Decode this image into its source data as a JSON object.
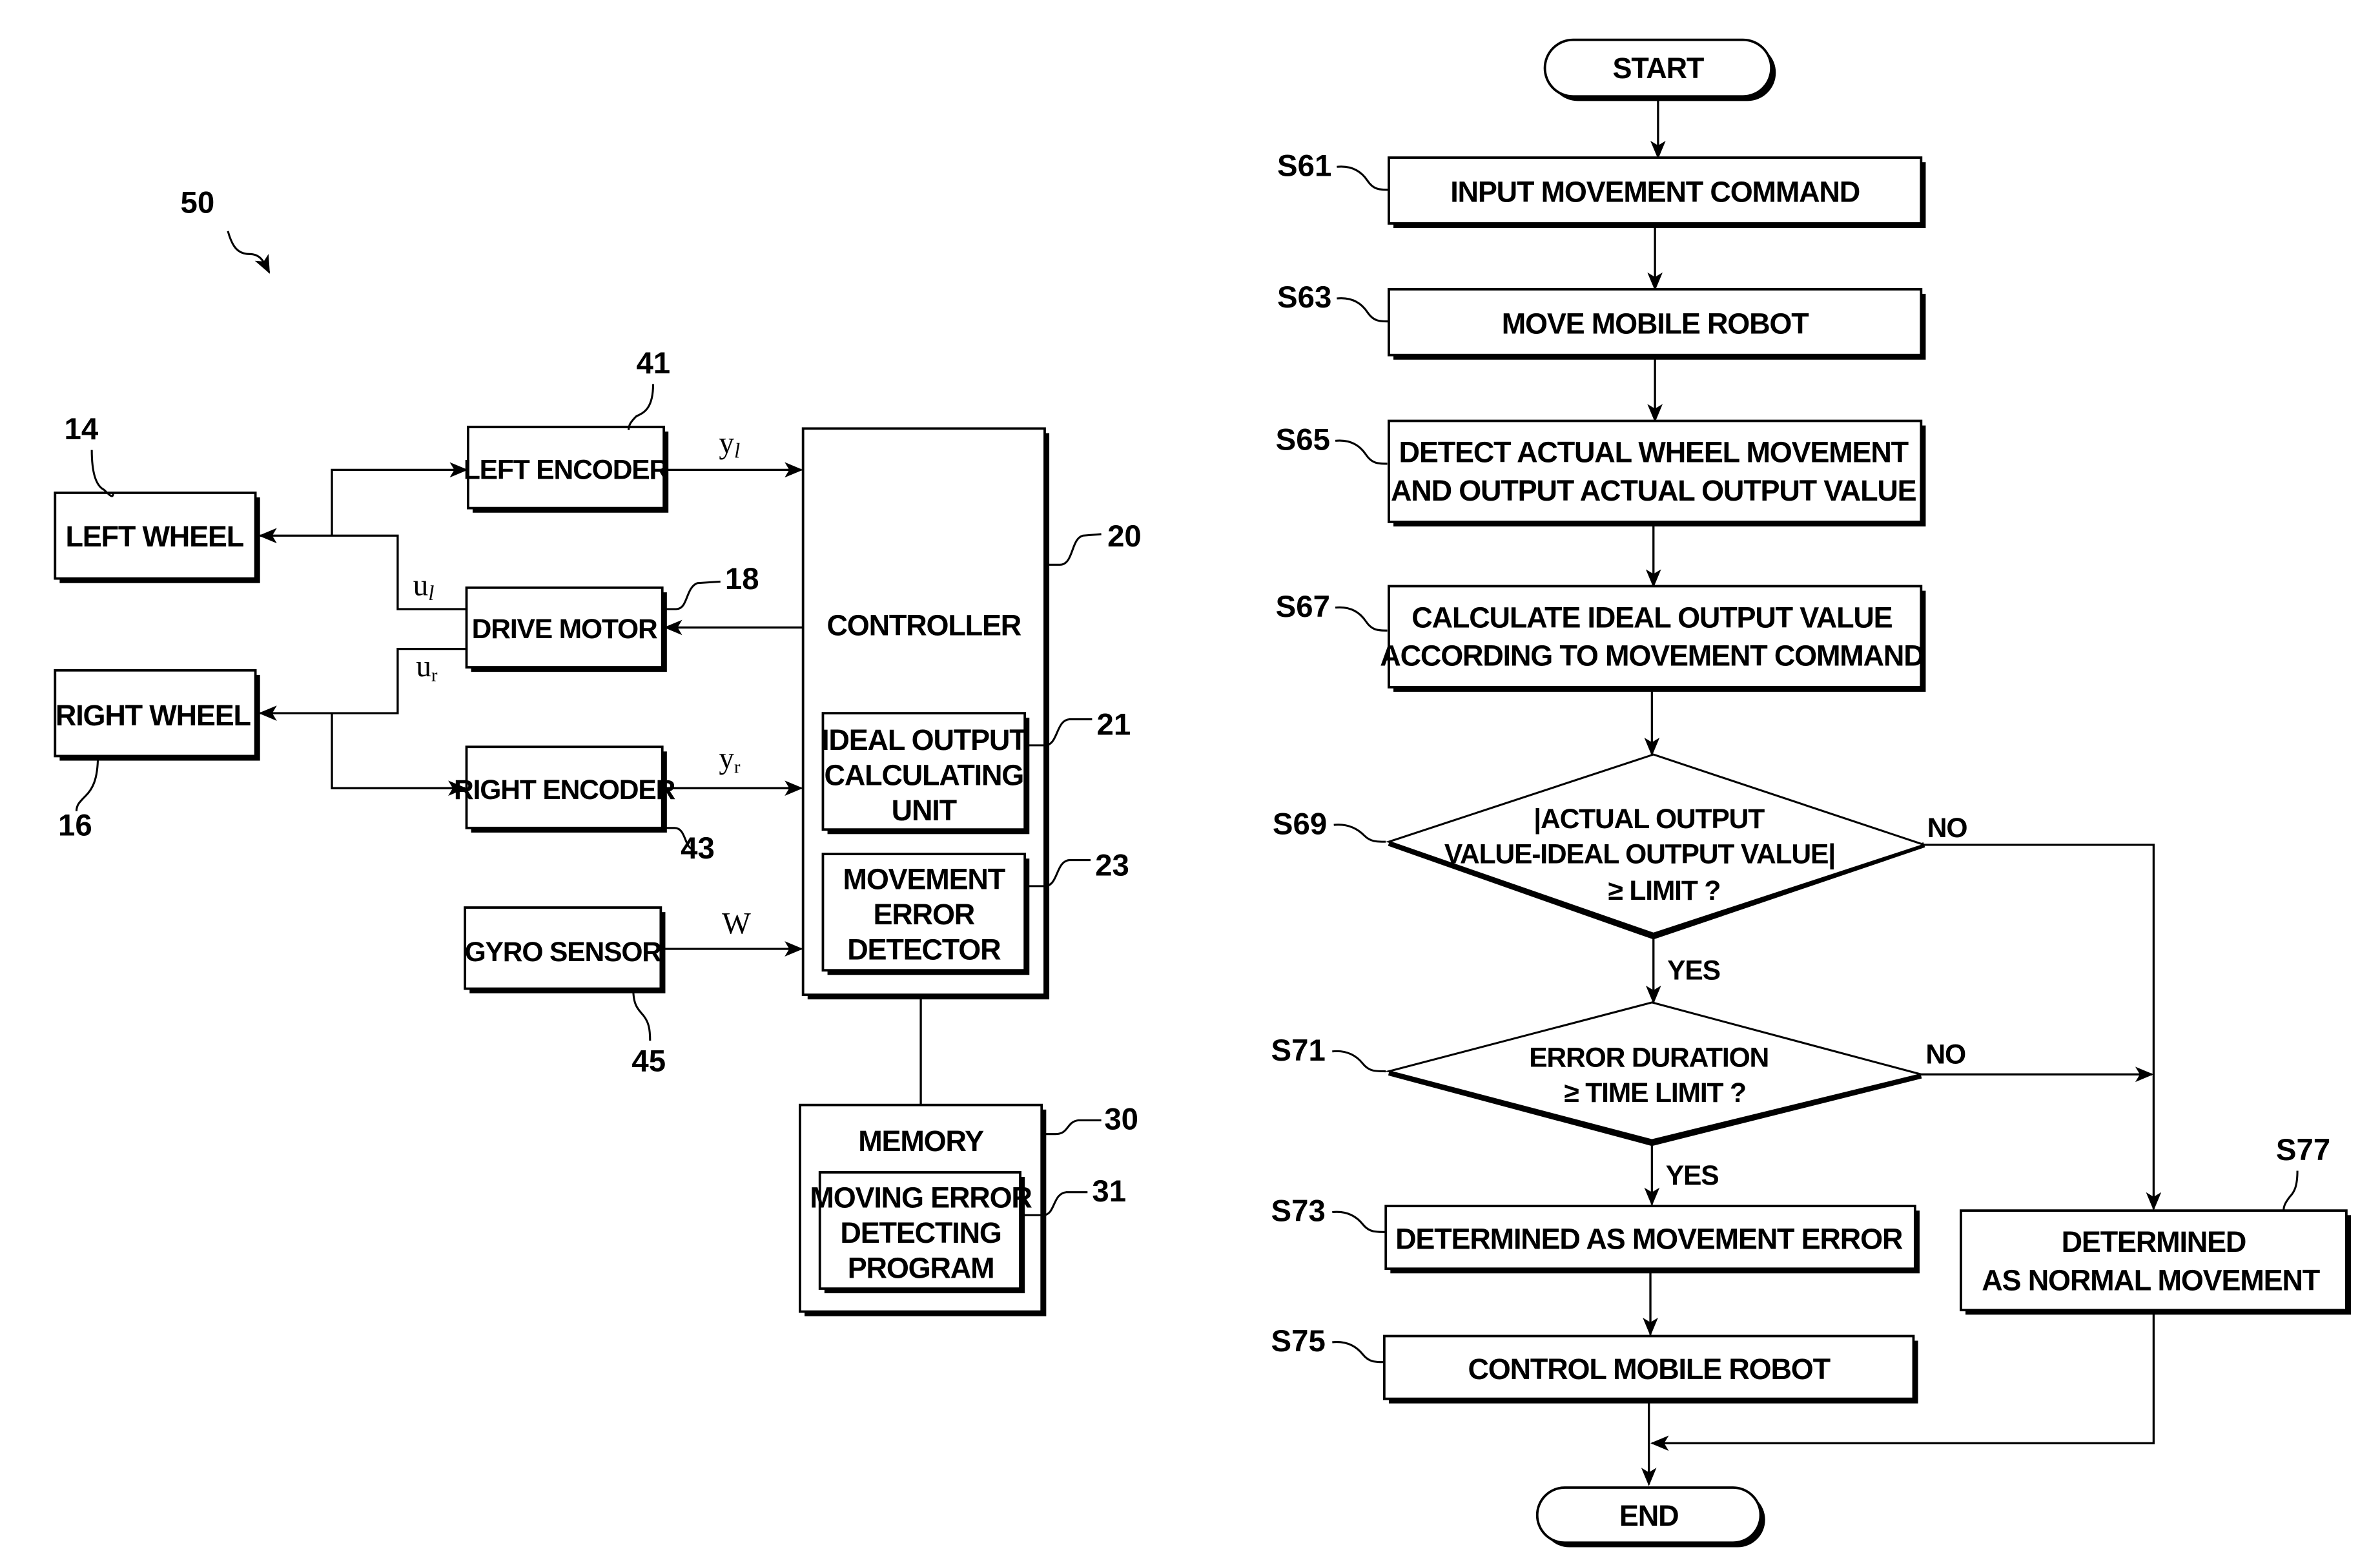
{
  "block_diagram": {
    "figure_ref": "50",
    "blocks": {
      "left_wheel": {
        "label": "LEFT WHEEL",
        "ref": "14"
      },
      "right_wheel": {
        "label": "RIGHT WHEEL",
        "ref": "16"
      },
      "left_encoder": {
        "label": "LEFT ENCODER",
        "ref": "41"
      },
      "drive_motor": {
        "label": "DRIVE MOTOR",
        "ref": "18"
      },
      "right_encoder": {
        "label": "RIGHT ENCODER",
        "ref": "43"
      },
      "gyro_sensor": {
        "label": "GYRO SENSOR",
        "ref": "45"
      },
      "controller": {
        "label": "CONTROLLER",
        "ref": "20"
      },
      "ideal_output_unit": {
        "lines": [
          "IDEAL OUTPUT",
          "CALCULATING",
          "UNIT"
        ],
        "ref": "21"
      },
      "movement_error_detector": {
        "lines": [
          "MOVEMENT",
          "ERROR",
          "DETECTOR"
        ],
        "ref": "23"
      },
      "memory": {
        "label": "MEMORY",
        "ref": "30"
      },
      "moving_error_program": {
        "lines": [
          "MOVING ERROR",
          "DETECTING",
          "PROGRAM"
        ],
        "ref": "31"
      }
    },
    "signals": {
      "y_left": {
        "base": "y",
        "sub": "l"
      },
      "y_right": {
        "base": "y",
        "sub": "r"
      },
      "u_left": {
        "base": "u",
        "sub": "l"
      },
      "u_right": {
        "base": "u",
        "sub": "r"
      },
      "w": "W"
    }
  },
  "flowchart": {
    "start": "START",
    "end": "END",
    "steps": {
      "s61": {
        "id": "S61",
        "lines": [
          "INPUT MOVEMENT COMMAND"
        ]
      },
      "s63": {
        "id": "S63",
        "lines": [
          "MOVE MOBILE ROBOT"
        ]
      },
      "s65": {
        "id": "S65",
        "lines": [
          "DETECT ACTUAL WHEEL MOVEMENT",
          "AND OUTPUT ACTUAL OUTPUT VALUE"
        ]
      },
      "s67": {
        "id": "S67",
        "lines": [
          "CALCULATE IDEAL OUTPUT VALUE",
          "ACCORDING TO MOVEMENT COMMAND"
        ]
      },
      "s69": {
        "id": "S69",
        "lines": [
          "|ACTUAL OUTPUT",
          "VALUE-IDEAL OUTPUT VALUE|",
          "≥ LIMIT ?"
        ]
      },
      "s71": {
        "id": "S71",
        "lines": [
          "ERROR DURATION",
          "≥ TIME LIMIT ?"
        ]
      },
      "s73": {
        "id": "S73",
        "lines": [
          "DETERMINED AS MOVEMENT ERROR"
        ]
      },
      "s75": {
        "id": "S75",
        "lines": [
          "CONTROL MOBILE ROBOT"
        ]
      },
      "s77": {
        "id": "S77",
        "lines": [
          "DETERMINED",
          "AS NORMAL MOVEMENT"
        ]
      }
    },
    "branch_labels": {
      "s69_yes": "YES",
      "s69_no": "NO",
      "s71_yes": "YES",
      "s71_no": "NO"
    }
  }
}
